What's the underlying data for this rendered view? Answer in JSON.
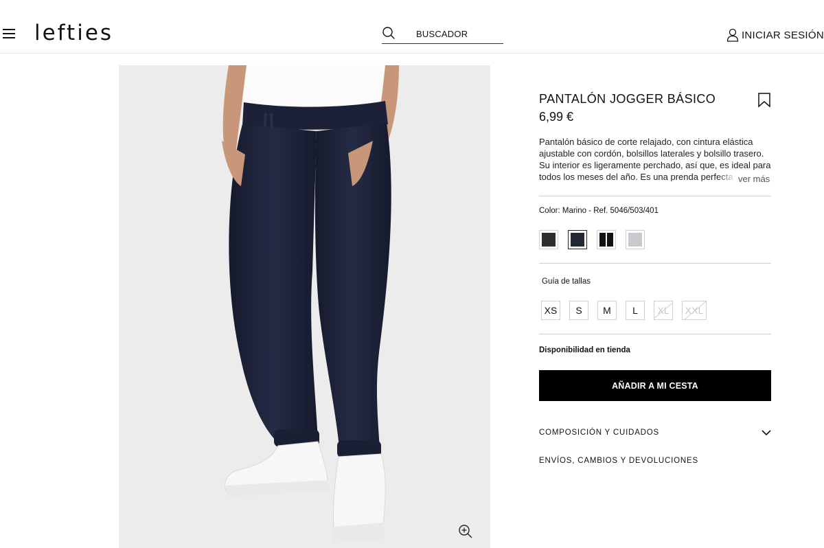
{
  "header": {
    "logo": "lefties",
    "search_label": "BUSCADOR",
    "login_label": "INICIAR SESIÓN"
  },
  "product": {
    "title": "PANTALÓN JOGGER BÁSICO",
    "price": "6,99 €",
    "description": "Pantalón básico de corte relajado, con cintura elástica ajustable con cordón, bolsillos laterales y bolsillo trasero. Su interior es ligeramente perchado, así que, es ideal para todos los meses del año. Es una prenda perfecta",
    "see_more": "ver más",
    "color_label": "Color: Marino - Ref. 5046/503/401",
    "colors": [
      {
        "name": "dark-grey",
        "hex": "#2e2e2e",
        "selected": false
      },
      {
        "name": "navy",
        "hex": "#232833",
        "selected": true
      },
      {
        "name": "black",
        "hex": "#111111",
        "selected": false
      },
      {
        "name": "light-grey",
        "hex": "#c9cacf",
        "selected": false
      }
    ],
    "size_guide": "Guía de tallas",
    "sizes": [
      {
        "label": "XS",
        "available": true
      },
      {
        "label": "S",
        "available": true
      },
      {
        "label": "M",
        "available": true
      },
      {
        "label": "L",
        "available": true
      },
      {
        "label": "XL",
        "available": false
      },
      {
        "label": "XXL",
        "available": false
      }
    ],
    "availability": "Disponibilidad en tienda",
    "add_to_cart": "AÑADIR A MI CESTA",
    "accordions": [
      {
        "label": "COMPOSICIÓN Y CUIDADOS",
        "has_chevron": true
      },
      {
        "label": "ENVÍOS, CAMBIOS Y DEVOLUCIONES",
        "has_chevron": false
      }
    ]
  },
  "colors": {
    "pants": "#1f2438",
    "background": "#ececec",
    "button": "#000000"
  }
}
